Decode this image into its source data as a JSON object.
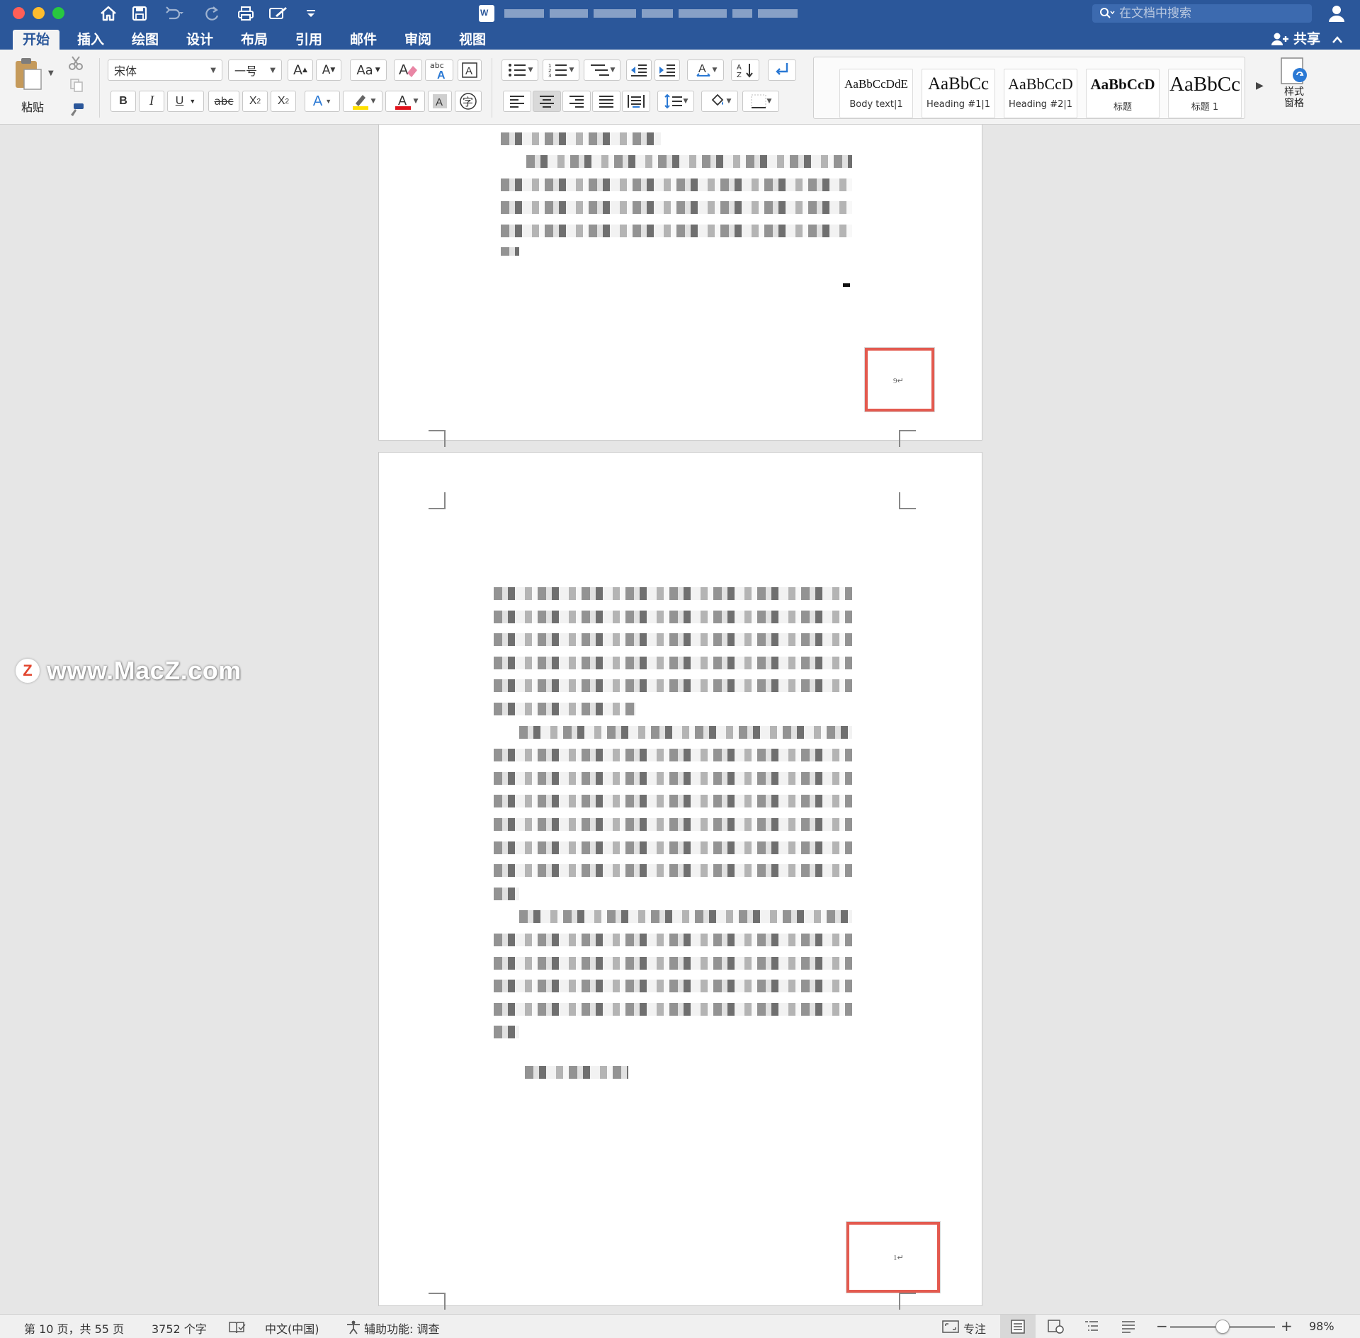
{
  "titlebar": {
    "colors": {
      "bar": "#2b579a",
      "close": "#ff5f57",
      "minimize": "#febc2e",
      "zoom": "#28c840"
    },
    "search_placeholder": "在文档中搜索"
  },
  "tabs": [
    {
      "label": "开始",
      "active": true
    },
    {
      "label": "插入"
    },
    {
      "label": "绘图"
    },
    {
      "label": "设计"
    },
    {
      "label": "布局"
    },
    {
      "label": "引用"
    },
    {
      "label": "邮件"
    },
    {
      "label": "审阅"
    },
    {
      "label": "视图"
    }
  ],
  "share_label": "共享",
  "ribbon": {
    "paste_label": "粘贴",
    "font_name": "宋体",
    "font_size": "一号",
    "styles": [
      {
        "preview": "AaBbCcDdE",
        "name": "Body text|1"
      },
      {
        "preview": "AaBbCc",
        "name": "Heading #1|1"
      },
      {
        "preview": "AaBbCcD",
        "name": "Heading #2|1"
      },
      {
        "preview": "AaBbCcD",
        "name": "标题"
      },
      {
        "preview": "AaBbCc",
        "name": "标题 1"
      }
    ],
    "styles_pane_label_1": "样式",
    "styles_pane_label_2": "窗格"
  },
  "pages": [
    {
      "page_number": "9↵"
    },
    {
      "page_number": "1↵"
    }
  ],
  "watermark": "www.MacZ.com",
  "statusbar": {
    "page_info": "第 10 页，共 55 页",
    "word_count": "3752 个字",
    "language": "中文(中国)",
    "accessibility": "辅助功能: 调查",
    "focus": "专注",
    "zoom": "98%",
    "zoom_level": 0.5
  },
  "highlight_color": "#e35a4f"
}
